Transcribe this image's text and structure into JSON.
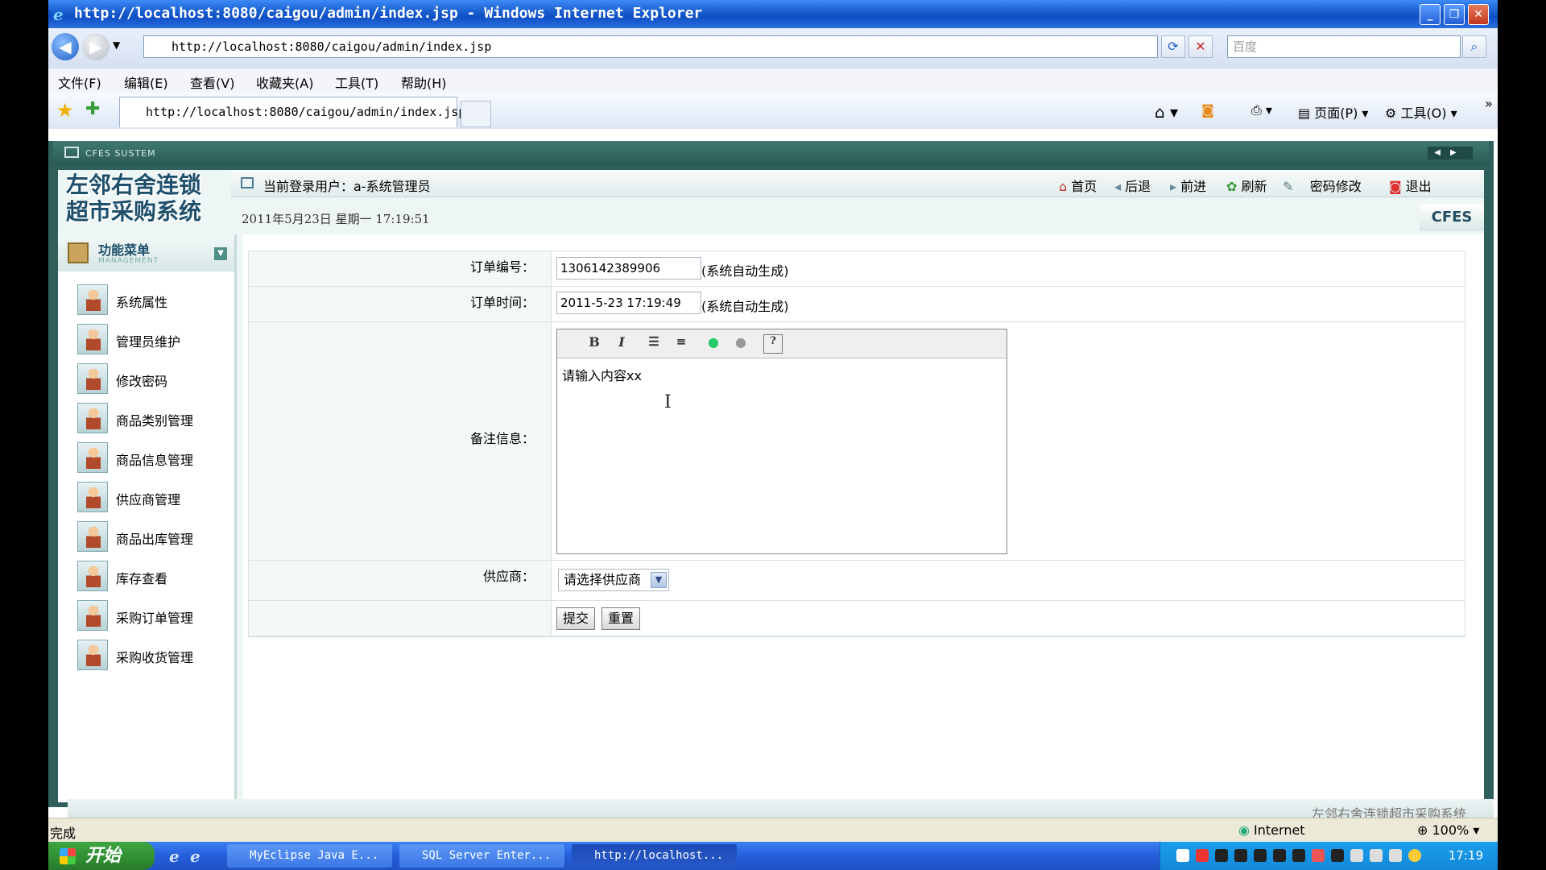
{
  "browser": {
    "title": "http://localhost:8080/caigou/admin/index.jsp - Windows Internet Explorer",
    "url": "http://localhost:8080/caigou/admin/index.jsp",
    "search_placeholder": "百度",
    "menu": [
      "文件(F)",
      "编辑(E)",
      "查看(V)",
      "收藏夹(A)",
      "工具(T)",
      "帮助(H)"
    ],
    "tab_label": "http://localhost:8080/caigou/admin/index.jsp",
    "commands": {
      "page": "页面(P)",
      "tools": "工具(O)"
    }
  },
  "app": {
    "system_label": "CFES SUSTEM",
    "logo": [
      "左邻右舍连锁",
      "超市采购系统"
    ],
    "current_user": "当前登录用户：a-系统管理员",
    "date_line": "2011年5月23日 星期一 17:19:51",
    "brand_badge": "CFES",
    "top_nav": [
      "首页",
      "后退",
      "前进",
      "刷新",
      "密码修改",
      "退出"
    ],
    "footer": "左邻右舍连锁超市采购系统"
  },
  "sidebar": {
    "title": "功能菜单",
    "subtitle": "MANAGEMENT",
    "items": [
      {
        "label": "系统属性"
      },
      {
        "label": "管理员维护"
      },
      {
        "label": "修改密码"
      },
      {
        "label": "商品类别管理"
      },
      {
        "label": "商品信息管理"
      },
      {
        "label": "供应商管理"
      },
      {
        "label": "商品出库管理"
      },
      {
        "label": "库存查看"
      },
      {
        "label": "采购订单管理"
      },
      {
        "label": "采购收货管理"
      }
    ]
  },
  "form": {
    "order_no_label": "订单编号：",
    "order_no_value": "1306142389906",
    "order_no_hint": "(系统自动生成)",
    "order_time_label": "订单时间：",
    "order_time_value": "2011-5-23 17:19:49",
    "order_time_hint": "(系统自动生成)",
    "remark_label": "备注信息：",
    "remark_text": "请输入内容xx",
    "supplier_label": "供应商：",
    "supplier_selected": "请选择供应商",
    "submit_label": "提交",
    "reset_label": "重置"
  },
  "status": {
    "text": "完成",
    "zone": "Internet",
    "zoom": "100%"
  },
  "taskbar": {
    "start": "开始",
    "buttons": [
      "MyEclipse Java E...",
      "SQL Server Enter...",
      "http://localhost..."
    ],
    "clock": "17:19"
  }
}
